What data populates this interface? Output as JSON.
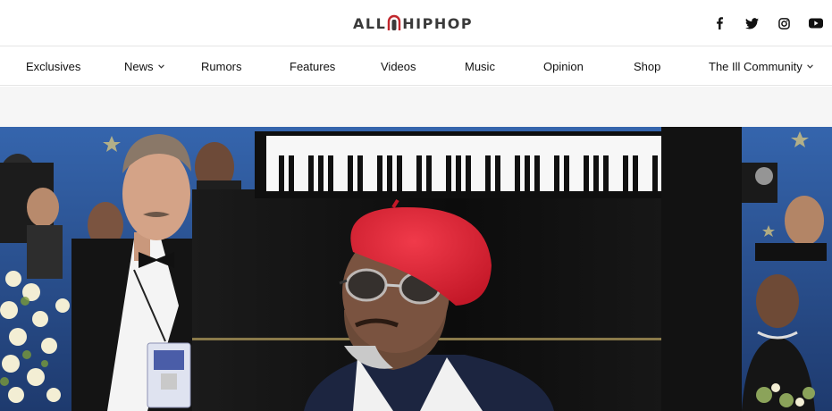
{
  "site": {
    "logo_text_left": "ALL",
    "logo_text_right": "HIPHOP"
  },
  "social": [
    {
      "icon": "facebook-icon"
    },
    {
      "icon": "twitter-icon"
    },
    {
      "icon": "instagram-icon"
    },
    {
      "icon": "youtube-icon"
    }
  ],
  "nav": {
    "items": [
      {
        "label": "Exclusives",
        "dropdown": false
      },
      {
        "label": "News",
        "dropdown": true
      },
      {
        "label": "Rumors",
        "dropdown": false
      },
      {
        "label": "Features",
        "dropdown": false
      },
      {
        "label": "Videos",
        "dropdown": false
      },
      {
        "label": "Music",
        "dropdown": false
      },
      {
        "label": "Opinion",
        "dropdown": false
      },
      {
        "label": "Shop",
        "dropdown": false
      },
      {
        "label": "The Ill Community",
        "dropdown": true
      }
    ]
  },
  "colors": {
    "hat": "#e0283a",
    "backdrop": "#2b4f8f",
    "piano": "#141414"
  }
}
